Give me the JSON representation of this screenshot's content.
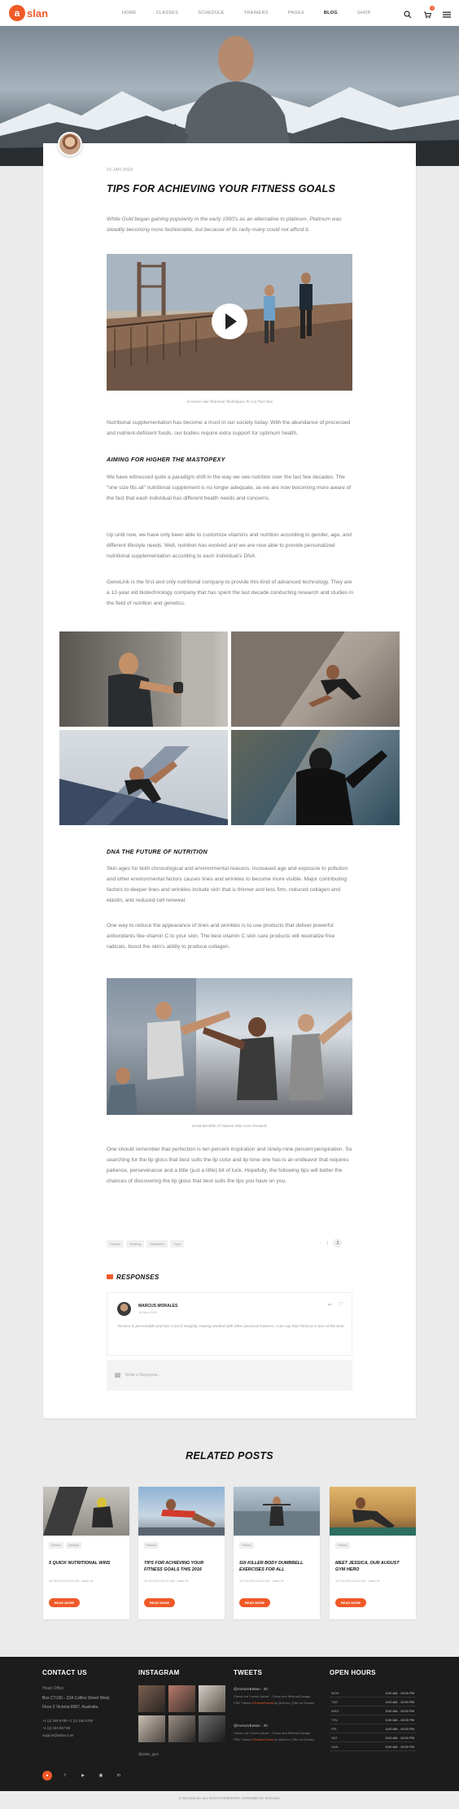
{
  "brand": {
    "logo_letter": "a",
    "logo_text": "slan",
    "accent": "#f05a28"
  },
  "nav": {
    "items": [
      "HOME",
      "CLASSES",
      "SCHEDULE",
      "TRAINERS",
      "PAGES",
      "BLOG",
      "SHOP"
    ],
    "active": "BLOG",
    "cart_count": "0"
  },
  "post": {
    "date": "15 JAN 2019",
    "title": "TIPS FOR ACHIEVING YOUR FITNESS GOALS",
    "lead": "White Gold began gaining popularity in the early 1900's as an alternative to platinum. Platinum was steadily becoming more fashionable, but because of its rarity many could not afford it.",
    "video_caption": "At-Home Hair Removal Techniques To Cry Part One",
    "p1": "Nutritional supplementation has become a must in our society today. With the abundance of processed and nutrient-deficient foods, our bodies require extra support for optimum health.",
    "h_mastopexy": "AIMING FOR HIGHER THE MASTOPEXY",
    "p2": "We have witnessed quite a paradigm shift in the way we see nutrition over the last few decades. The \"one size fits all\" nutritional supplement is no longer adequate, as we are now becoming more aware of the fact that each individual has different health needs and concerns.",
    "p3": "Up until now, we have only been able to customize vitamins and nutrition according to gender, age, and different lifestyle needs. Well, nutrition has evolved and we are now able to provide personalized nutritional supplementation according to each individual's DNA.",
    "p4": "GeneLink is the first and only nutritional company to provide this kind of advanced technology. They are a 12-year old biotechnology company that has spent the last decade conducting research and studies in the field of nutrition and genetics.",
    "h_dna": "DNA THE FUTURE OF NUTRITION",
    "p5": "Skin ages for both chronological and environmental reasons. Increased age and exposure to pollution and other environmental factors causes lines and wrinkles to become more visible. Major contributing factors to deeper lines and wrinkles include skin that is thinner and less firm, reduced collagen and elastin, and reduced cell renewal.",
    "p6": "One way to reduce the appearance of lines and wrinkles is to use products that deliver powerful antioxidants like vitamin C to your skin. The best vitamin C skin care products will neutralize free radicals, boost the skin's ability to produce collagen.",
    "image_caption": "Great Benefits Of Natural Skin Care Products",
    "p7": "One should remember that perfection is ten percent inspiration and ninety-nine percent perspiration. So searching for the lip gloss that best suits the lip color and lip tone one has is an endeavor that requires patience, perseverance and a little (just a little) bit of luck. Hopefully, the following tips will better the chances of discovering the lip gloss that best suits the lips you have on you.",
    "tags": [
      "Fitness",
      "Training",
      "Motivation",
      "Gym"
    ],
    "pager": [
      "‹",
      "1",
      "2"
    ]
  },
  "responses": {
    "title": "RESPONSES",
    "comment": {
      "name": "MARCUS MORALES",
      "date": "16 Nov 2019",
      "text": "Tenisca is personable and has a lot of integrity. Having worked with other personal trainers, I can say that Tenisca is one of the best."
    },
    "write_placeholder": "Write a Response..."
  },
  "related": {
    "title": "RELATED POSTS",
    "items": [
      {
        "tags": [
          "Fitness",
          "Lifestyle"
        ],
        "title": "5 QUICK NUTRITIONAL WINS",
        "meta": "16 Oct 2019 at 6:11 AM   ·   Aslan Ve",
        "button": "READ MORE"
      },
      {
        "tags": [
          "Fitness"
        ],
        "title": "TIPS FOR ACHIEVING YOUR FITNESS GOALS THIS 2016",
        "meta": "16 Oct 2019 at 6:11 AM   ·   Aslan Ve",
        "button": "READ MORE"
      },
      {
        "tags": [
          "Fitness"
        ],
        "title": "SIX KILLER BODY DUMBBELL EXERCISES FOR ALL",
        "meta": "16 Oct 2019 at 6:11 AM   ·   Aslan Ve",
        "button": "READ MORE"
      },
      {
        "tags": [
          "Fitness"
        ],
        "title": "MEET JESSICA, OUR AUGUST GYM HERO",
        "meta": "16 Oct 2019 at 6:11 AM   ·   Aslan Ve",
        "button": "READ MORE"
      }
    ]
  },
  "footer": {
    "contact": {
      "title": "CONTACT US",
      "office": "Head Office",
      "address1": "Box CT160 - 22A Collins Street West,",
      "address2": "Floor 2 Victoria 8007, Australia.",
      "phone": "+1 (2) 345 6789     +1 (2) 345 6780",
      "fax": "+1 (2) 234 567 89",
      "email": "support@aslan.com"
    },
    "instagram": {
      "title": "INSTAGRAM",
      "user": "@aslan_gym"
    },
    "tweets": {
      "title": "TWEETS",
      "items": [
        {
          "name": "@AvrooVEesan",
          "when": "· 2h",
          "text": "Check out 'Lorem Ipsum' - Clean and Minimal Design PSD Theme ",
          "link": "#ThemeForest",
          "text2": " by @Avroo_Elite on Envato ..."
        },
        {
          "name": "@AvrooVEesan",
          "when": "· 2h",
          "text": "Check out 'Lorem Ipsum' - Clean and Minimal Design PSD Theme ",
          "link": "#ThemeForest",
          "text2": " by @Avroo_Elite on Envato ..."
        }
      ]
    },
    "hours": {
      "title": "OPEN HOURS",
      "rows": [
        {
          "day": "MON",
          "time": "5:00 AM - 10:00 PM"
        },
        {
          "day": "TUE",
          "time": "5:00 AM - 10:00 PM"
        },
        {
          "day": "WED",
          "time": "5:00 AM - 10:00 PM"
        },
        {
          "day": "THU",
          "time": "5:00 AM - 10:00 PM"
        },
        {
          "day": "FRI",
          "time": "5:00 AM - 10:00 PM"
        },
        {
          "day": "SAT",
          "time": "6:00 AM - 10:00 PM"
        },
        {
          "day": "SUN",
          "time": "6:00 AM - 10:00 PM"
        }
      ]
    },
    "copyright": "© 2019 ASLAN. ALL RIGHTS RESERVED. DESIGNED BY ELEGANL"
  }
}
